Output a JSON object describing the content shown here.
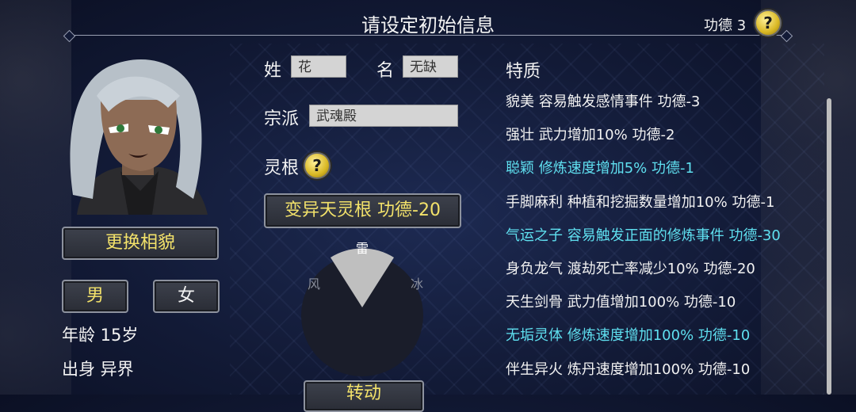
{
  "header": {
    "title": "请设定初始信息",
    "merit_label": "功德 3",
    "help_icon": "?"
  },
  "character": {
    "change_face_label": "更换相貌",
    "gender_male": "男",
    "gender_female": "女",
    "age_label": "年龄 15岁",
    "origin_label": "出身 异界"
  },
  "form": {
    "surname_label": "姓",
    "surname_value": "花",
    "name_label": "名",
    "name_value": "无缺",
    "sect_label": "宗派",
    "sect_value": "武魂殿",
    "spirit_root_label": "灵根",
    "spirit_root_button": "变异天灵根 功德-20",
    "bottom_button": "转动"
  },
  "wheel": {
    "top": "雷",
    "left": "风",
    "right": "冰"
  },
  "traits": {
    "title": "特质",
    "items": [
      {
        "text": "貌美 容易触发感情事件 功德-3",
        "highlight": false
      },
      {
        "text": "强壮 武力增加10% 功德-2",
        "highlight": false
      },
      {
        "text": "聪颖 修炼速度增加5% 功德-1",
        "highlight": true
      },
      {
        "text": "手脚麻利 种植和挖掘数量增加10% 功德-1",
        "highlight": false
      },
      {
        "text": "气运之子 容易触发正面的修炼事件 功德-30",
        "highlight": true
      },
      {
        "text": "身负龙气 渡劫死亡率减少10% 功德-20",
        "highlight": false
      },
      {
        "text": "天生剑骨 武力值增加100% 功德-10",
        "highlight": false
      },
      {
        "text": "无垢灵体 修炼速度增加100% 功德-10",
        "highlight": true
      },
      {
        "text": "伴生异火 炼丹速度增加100% 功德-10",
        "highlight": false
      }
    ]
  },
  "colors": {
    "highlight": "#5fe0f0",
    "button_text": "#f3e26a",
    "background": "#121a36"
  }
}
